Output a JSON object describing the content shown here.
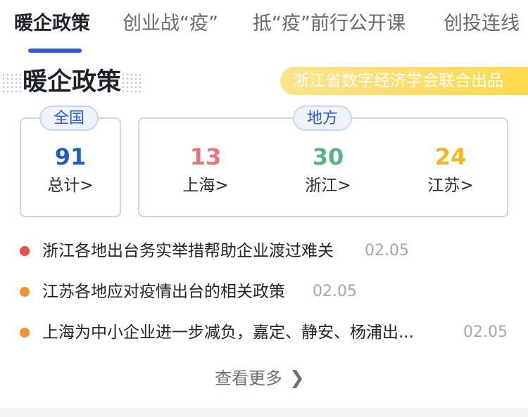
{
  "tabs": [
    {
      "label": "暖企政策",
      "active": true
    },
    {
      "label": "创业战“疫”",
      "active": false
    },
    {
      "label": "抵“疫”前行公开课",
      "active": false
    },
    {
      "label": "创投连线",
      "active": false
    }
  ],
  "section": {
    "title": "暖企政策",
    "source_badge": "浙江省数字经济学会联合出品"
  },
  "national": {
    "label": "全国",
    "count": "91",
    "link_label": "总计>"
  },
  "local": {
    "label": "地方",
    "items": [
      {
        "count": "13",
        "label": "上海>",
        "color": "#e9757c"
      },
      {
        "count": "30",
        "label": "浙江>",
        "color": "#58b483"
      },
      {
        "count": "24",
        "label": "江苏>",
        "color": "#f3b724"
      }
    ]
  },
  "colors": {
    "accent": "#2f5bd3",
    "national_count": "#1f5fc8"
  },
  "news": [
    {
      "title": "浙江各地出台务实举措帮助企业渡过难关",
      "date": "02.05",
      "dot_color": "#ec4f3d"
    },
    {
      "title": "江苏各地应对疫情出台的相关政策",
      "date": "02.05",
      "dot_color": "#f5922f"
    },
    {
      "title": "上海为中小企业进一步减负，嘉定、静安、杨浦出...",
      "date": "02.05",
      "dot_color": "#f5922f"
    }
  ],
  "more": {
    "label": "查看更多",
    "icon": "chevron-right-icon"
  }
}
